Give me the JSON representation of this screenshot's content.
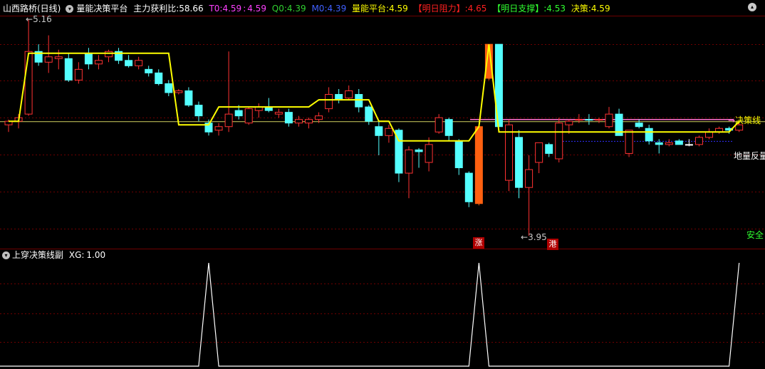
{
  "header": {
    "stock_name": "山西路桥(日线)",
    "indicator_name": "量能决策平台",
    "main_force_label": "主力获利比:",
    "main_force_value": "58.66",
    "t0_label": "T0:",
    "t0_value": "4.59",
    "t0_sep": ":",
    "t0_value2": "4.59",
    "q0_label": "Q0:",
    "q0_value": "4.39",
    "m0_label": "M0:",
    "m0_value": "4.39",
    "platform_label": "量能平台:",
    "platform_value": "4.59",
    "resistance_label": "【明日阻力】:",
    "resistance_value": "4.65",
    "support_label": "【明日支撑】:",
    "support_value": "4.53",
    "decision_label": "决策:",
    "decision_value": "4.59"
  },
  "sub_header": {
    "indicator_name": "上穿决策线副",
    "xg_label": "XG:",
    "xg_value": "1.00"
  },
  "annotations": {
    "high_label": "5.16",
    "low_label": "3.95",
    "decision_line_label": "决策线",
    "ground_label": "地量反量",
    "safe_label": "安全",
    "signal_up": "涨",
    "signal_port": "港"
  },
  "colors": {
    "up": "#ff3232",
    "down": "#54ffff",
    "hot": "#ff6010",
    "decision": "#ffff00",
    "resistance_line": "#ff70d0",
    "support_line": "#3030ff",
    "grid": "#6e0000"
  },
  "chart_data": [
    {
      "type": "candlestick",
      "price_range": [
        3.95,
        5.16
      ],
      "candles": [
        {
          "o": 4.57,
          "h": 4.6,
          "l": 4.53,
          "c": 4.59,
          "d": "u"
        },
        {
          "o": 4.59,
          "h": 4.63,
          "l": 4.55,
          "c": 4.61,
          "d": "u"
        },
        {
          "o": 4.63,
          "h": 5.16,
          "l": 4.62,
          "c": 4.98,
          "d": "u"
        },
        {
          "o": 4.98,
          "h": 5.02,
          "l": 4.9,
          "c": 4.92,
          "d": "d"
        },
        {
          "o": 4.92,
          "h": 5.07,
          "l": 4.86,
          "c": 4.95,
          "d": "u"
        },
        {
          "o": 4.95,
          "h": 4.99,
          "l": 4.88,
          "c": 4.94,
          "d": "u"
        },
        {
          "o": 4.94,
          "h": 4.97,
          "l": 4.81,
          "c": 4.82,
          "d": "d"
        },
        {
          "o": 4.82,
          "h": 4.92,
          "l": 4.8,
          "c": 4.88,
          "d": "u"
        },
        {
          "o": 4.97,
          "h": 5.0,
          "l": 4.88,
          "c": 4.91,
          "d": "d"
        },
        {
          "o": 4.91,
          "h": 4.96,
          "l": 4.88,
          "c": 4.93,
          "d": "u"
        },
        {
          "o": 4.95,
          "h": 4.99,
          "l": 4.92,
          "c": 4.98,
          "d": "u"
        },
        {
          "o": 4.98,
          "h": 5.0,
          "l": 4.91,
          "c": 4.93,
          "d": "d"
        },
        {
          "o": 4.93,
          "h": 4.96,
          "l": 4.89,
          "c": 4.9,
          "d": "d"
        },
        {
          "o": 4.9,
          "h": 4.95,
          "l": 4.88,
          "c": 4.93,
          "d": "u"
        },
        {
          "o": 4.88,
          "h": 4.9,
          "l": 4.84,
          "c": 4.86,
          "d": "d"
        },
        {
          "o": 4.86,
          "h": 4.88,
          "l": 4.79,
          "c": 4.8,
          "d": "d"
        },
        {
          "o": 4.8,
          "h": 4.82,
          "l": 4.73,
          "c": 4.75,
          "d": "d"
        },
        {
          "o": 4.75,
          "h": 4.77,
          "l": 4.74,
          "c": 4.76,
          "d": "u"
        },
        {
          "o": 4.76,
          "h": 4.78,
          "l": 4.67,
          "c": 4.68,
          "d": "d"
        },
        {
          "o": 4.68,
          "h": 4.7,
          "l": 4.59,
          "c": 4.62,
          "d": "d"
        },
        {
          "o": 4.58,
          "h": 4.6,
          "l": 4.51,
          "c": 4.53,
          "d": "d"
        },
        {
          "o": 4.54,
          "h": 4.58,
          "l": 4.51,
          "c": 4.56,
          "d": "u"
        },
        {
          "o": 4.56,
          "h": 4.98,
          "l": 4.53,
          "c": 4.63,
          "d": "u"
        },
        {
          "o": 4.65,
          "h": 4.68,
          "l": 4.6,
          "c": 4.62,
          "d": "d"
        },
        {
          "o": 4.58,
          "h": 4.67,
          "l": 4.57,
          "c": 4.66,
          "d": "u"
        },
        {
          "o": 4.65,
          "h": 4.69,
          "l": 4.61,
          "c": 4.67,
          "d": "u"
        },
        {
          "o": 4.67,
          "h": 4.72,
          "l": 4.64,
          "c": 4.65,
          "d": "d"
        },
        {
          "o": 4.63,
          "h": 4.66,
          "l": 4.61,
          "c": 4.64,
          "d": "u"
        },
        {
          "o": 4.64,
          "h": 4.66,
          "l": 4.56,
          "c": 4.58,
          "d": "d"
        },
        {
          "o": 4.58,
          "h": 4.62,
          "l": 4.56,
          "c": 4.6,
          "d": "u"
        },
        {
          "o": 4.58,
          "h": 4.61,
          "l": 4.55,
          "c": 4.6,
          "d": "u"
        },
        {
          "o": 4.6,
          "h": 4.64,
          "l": 4.58,
          "c": 4.62,
          "d": "u"
        },
        {
          "o": 4.66,
          "h": 4.78,
          "l": 4.64,
          "c": 4.74,
          "d": "u"
        },
        {
          "o": 4.74,
          "h": 4.77,
          "l": 4.69,
          "c": 4.71,
          "d": "d"
        },
        {
          "o": 4.72,
          "h": 4.79,
          "l": 4.71,
          "c": 4.76,
          "d": "u"
        },
        {
          "o": 4.74,
          "h": 4.77,
          "l": 4.64,
          "c": 4.67,
          "d": "d"
        },
        {
          "o": 4.67,
          "h": 4.68,
          "l": 4.57,
          "c": 4.59,
          "d": "d"
        },
        {
          "o": 4.56,
          "h": 4.59,
          "l": 4.4,
          "c": 4.51,
          "d": "d"
        },
        {
          "o": 4.51,
          "h": 4.57,
          "l": 4.47,
          "c": 4.55,
          "d": "u"
        },
        {
          "o": 4.54,
          "h": 4.55,
          "l": 4.25,
          "c": 4.3,
          "d": "d"
        },
        {
          "o": 4.3,
          "h": 4.45,
          "l": 4.16,
          "c": 4.43,
          "d": "u"
        },
        {
          "o": 4.42,
          "h": 4.44,
          "l": 4.33,
          "c": 4.43,
          "d": "d"
        },
        {
          "o": 4.36,
          "h": 4.5,
          "l": 4.31,
          "c": 4.46,
          "d": "u"
        },
        {
          "o": 4.53,
          "h": 4.63,
          "l": 4.52,
          "c": 4.61,
          "d": "u"
        },
        {
          "o": 4.6,
          "h": 4.61,
          "l": 4.48,
          "c": 4.51,
          "d": "d"
        },
        {
          "o": 4.48,
          "h": 4.49,
          "l": 4.29,
          "c": 4.33,
          "d": "d"
        },
        {
          "o": 4.3,
          "h": 4.31,
          "l": 4.11,
          "c": 4.14,
          "d": "d"
        },
        {
          "o": 4.13,
          "h": 4.57,
          "l": 4.12,
          "c": 4.56,
          "d": "h"
        },
        {
          "o": 4.83,
          "h": 5.02,
          "l": 4.82,
          "c": 5.02,
          "d": "h"
        },
        {
          "o": 5.02,
          "h": 5.02,
          "l": 4.56,
          "c": 4.56,
          "d": "d"
        },
        {
          "o": 4.57,
          "h": 4.6,
          "l": 4.2,
          "c": 4.26,
          "d": "u"
        },
        {
          "o": 4.5,
          "h": 4.54,
          "l": 4.16,
          "c": 4.22,
          "d": "d"
        },
        {
          "o": 4.22,
          "h": 4.4,
          "l": 3.95,
          "c": 4.32,
          "d": "u"
        },
        {
          "o": 4.36,
          "h": 4.46,
          "l": 4.3,
          "c": 4.47,
          "d": "u"
        },
        {
          "o": 4.46,
          "h": 4.47,
          "l": 4.39,
          "c": 4.41,
          "d": "d"
        },
        {
          "o": 4.38,
          "h": 4.61,
          "l": 4.36,
          "c": 4.58,
          "d": "u"
        },
        {
          "o": 4.57,
          "h": 4.6,
          "l": 4.52,
          "c": 4.59,
          "d": "u"
        },
        {
          "o": 4.6,
          "h": 4.63,
          "l": 4.58,
          "c": 4.6,
          "d": "u"
        },
        {
          "o": 4.6,
          "h": 4.63,
          "l": 4.57,
          "c": 4.6,
          "d": "d"
        },
        {
          "o": 4.6,
          "h": 4.61,
          "l": 4.58,
          "c": 4.6,
          "d": "u"
        },
        {
          "o": 4.63,
          "h": 4.67,
          "l": 4.55,
          "c": 4.56,
          "d": "u"
        },
        {
          "o": 4.63,
          "h": 4.66,
          "l": 4.52,
          "c": 4.51,
          "d": "d"
        },
        {
          "o": 4.41,
          "h": 4.48,
          "l": 4.39,
          "c": 4.54,
          "d": "u"
        },
        {
          "o": 4.58,
          "h": 4.6,
          "l": 4.55,
          "c": 4.56,
          "d": "d"
        },
        {
          "o": 4.55,
          "h": 4.57,
          "l": 4.46,
          "c": 4.48,
          "d": "d"
        },
        {
          "o": 4.47,
          "h": 4.49,
          "l": 4.41,
          "c": 4.46,
          "d": "d"
        },
        {
          "o": 4.46,
          "h": 4.49,
          "l": 4.45,
          "c": 4.47,
          "d": "u"
        },
        {
          "o": 4.48,
          "h": 4.49,
          "l": 4.46,
          "c": 4.46,
          "d": "d"
        },
        {
          "o": 4.46,
          "h": 4.49,
          "l": 4.45,
          "c": 4.46,
          "d": "w"
        },
        {
          "o": 4.46,
          "h": 4.51,
          "l": 4.45,
          "c": 4.5,
          "d": "u"
        },
        {
          "o": 4.5,
          "h": 4.55,
          "l": 4.49,
          "c": 4.53,
          "d": "u"
        },
        {
          "o": 4.53,
          "h": 4.56,
          "l": 4.52,
          "c": 4.55,
          "d": "u"
        },
        {
          "o": 4.55,
          "h": 4.56,
          "l": 4.52,
          "c": 4.54,
          "d": "d"
        },
        {
          "o": 4.54,
          "h": 4.59,
          "l": 4.53,
          "c": 4.57,
          "d": "u"
        }
      ],
      "decision_line": [
        4.59,
        4.59,
        4.97,
        4.97,
        4.97,
        4.97,
        4.97,
        4.97,
        4.97,
        4.97,
        4.97,
        4.97,
        4.97,
        4.97,
        4.97,
        4.97,
        4.97,
        4.57,
        4.57,
        4.57,
        4.57,
        4.67,
        4.67,
        4.67,
        4.67,
        4.67,
        4.67,
        4.67,
        4.67,
        4.67,
        4.67,
        4.71,
        4.71,
        4.71,
        4.71,
        4.71,
        4.71,
        4.59,
        4.59,
        4.48,
        4.48,
        4.48,
        4.48,
        4.48,
        4.48,
        4.48,
        4.48,
        4.56,
        5.02,
        4.53,
        4.53,
        4.53,
        4.53,
        4.53,
        4.53,
        4.53,
        4.53,
        4.53,
        4.53,
        4.53,
        4.53,
        4.53,
        4.53,
        4.53,
        4.53,
        4.53,
        4.53,
        4.53,
        4.53,
        4.53,
        4.53,
        4.53,
        4.53,
        4.59
      ],
      "resistance_level": 4.6,
      "support_level": 4.48
    },
    {
      "type": "line",
      "title": "上穿决策线副",
      "series": [
        {
          "name": "XG",
          "values": [
            0,
            0,
            0,
            0,
            0,
            0,
            0,
            0,
            0,
            0,
            0,
            0,
            0,
            0,
            0,
            0,
            0,
            0,
            0,
            0,
            1,
            0,
            0,
            0,
            0,
            0,
            0,
            0,
            0,
            0,
            0,
            0,
            0,
            0,
            0,
            0,
            0,
            0,
            0,
            0,
            0,
            0,
            0,
            0,
            0,
            0,
            0,
            1,
            0,
            0,
            0,
            0,
            0,
            0,
            0,
            0,
            0,
            0,
            0,
            0,
            0,
            0,
            0,
            0,
            0,
            0,
            0,
            0,
            0,
            0,
            0,
            0,
            0,
            1
          ]
        }
      ],
      "ylim": [
        0,
        1
      ]
    }
  ]
}
